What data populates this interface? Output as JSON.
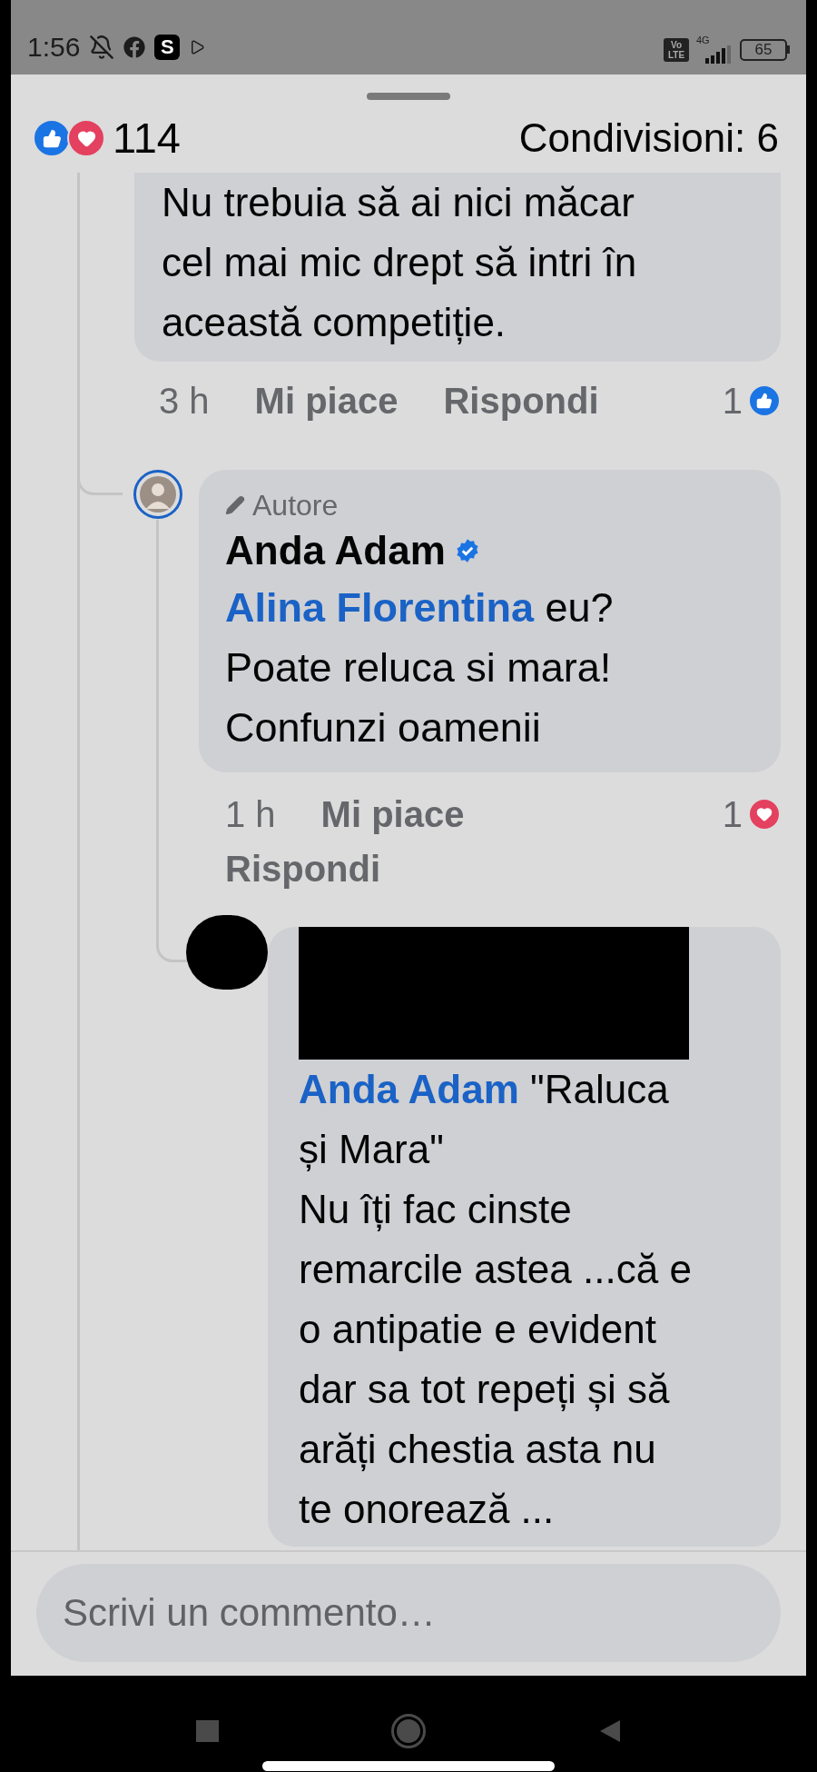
{
  "status_bar": {
    "time": "1:56",
    "app_badge": "S",
    "volte": [
      "Vo",
      "LTE"
    ],
    "network": "4G",
    "battery": "65"
  },
  "header": {
    "reactions": [
      {
        "kind": "like"
      },
      {
        "kind": "love"
      }
    ],
    "reaction_count": "114",
    "shares": "Condivisioni: 6"
  },
  "comments": [
    {
      "kind": "top",
      "lines": [
        "Nu trebuia să ai nici măcar",
        "cel mai mic drept să intri în",
        "această competiție."
      ],
      "time": "3 h",
      "actions": [
        "Mi piace",
        "Rispondi"
      ],
      "reaction_count": "1",
      "reaction": {
        "kind": "like"
      }
    },
    {
      "kind": "reply",
      "badge": "Autore",
      "author": "Anda Adam",
      "verified": true,
      "mention": "Alina Florentina",
      "lines": [
        "eu?",
        "Poate reluca si mara!",
        "Confunzi oamenii"
      ],
      "time": "1 h",
      "actions": [
        "Mi piace",
        "Rispondi"
      ],
      "reaction_count": "1",
      "reaction": {
        "kind": "love"
      }
    },
    {
      "kind": "nested",
      "redacted": true,
      "mention": "Anda Adam",
      "lines": [
        "\"Raluca",
        "și Mara\"",
        "Nu îți fac cinste",
        "remarcile astea ...că e",
        "o antipatie e evident",
        "dar sa tot repeți și să",
        "arăți chestia asta nu",
        "te onorează ..."
      ]
    }
  ],
  "composer": {
    "placeholder": "Scrivi un commento…"
  }
}
